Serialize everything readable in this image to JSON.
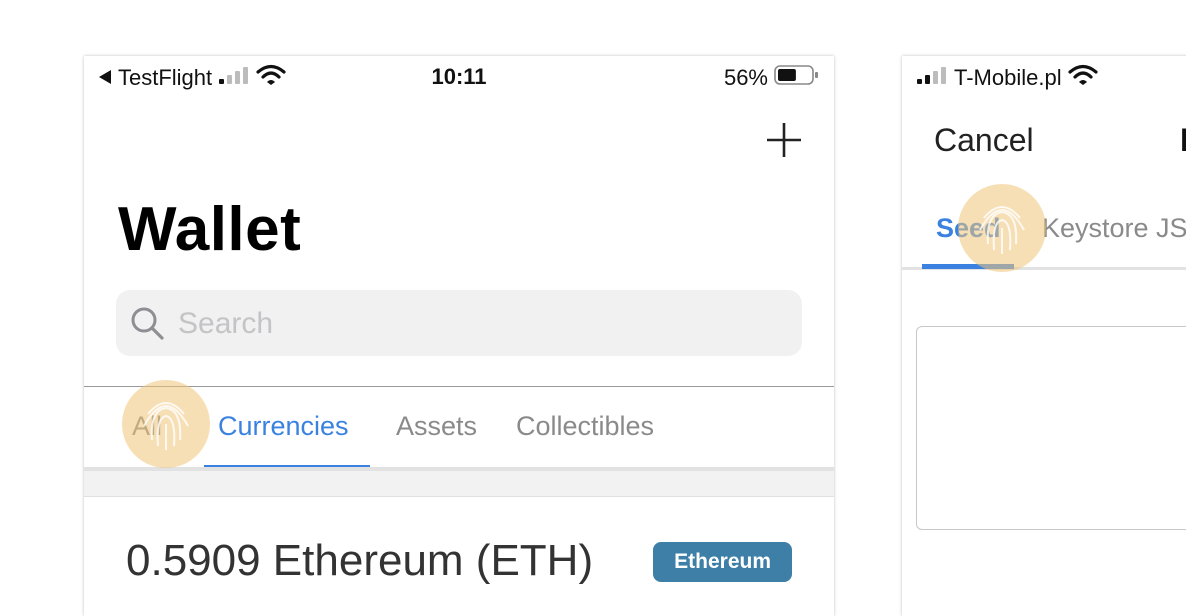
{
  "phone1": {
    "status": {
      "back_app": "TestFlight",
      "time": "10:11",
      "battery": "56%",
      "battery_level": 0.56
    },
    "page_title": "Wallet",
    "search": {
      "placeholder": "Search"
    },
    "tabs": [
      {
        "label": "All",
        "active": false
      },
      {
        "label": "Currencies",
        "active": true
      },
      {
        "label": "Assets",
        "active": false
      },
      {
        "label": "Collectibles",
        "active": false
      }
    ],
    "items": [
      {
        "name": "0.5909 Ethereum (ETH)",
        "badge": "Ethereum"
      }
    ]
  },
  "phone2": {
    "status": {
      "carrier": "T-Mobile.pl"
    },
    "cancel_label": "Cancel",
    "title_fragment": "I",
    "tabs": [
      {
        "label": "Seed",
        "active": true
      },
      {
        "label": "Keystore JS",
        "active": false
      }
    ]
  },
  "colors": {
    "accent": "#3b82e0",
    "badge": "#3d7fa6",
    "search_bg": "#f1f1f2",
    "touch_indicator": "#f0c478"
  },
  "icons": [
    "back-arrow-icon",
    "signal-icon",
    "wifi-icon",
    "battery-icon",
    "plus-icon",
    "search-icon",
    "fingerprint-icon"
  ]
}
